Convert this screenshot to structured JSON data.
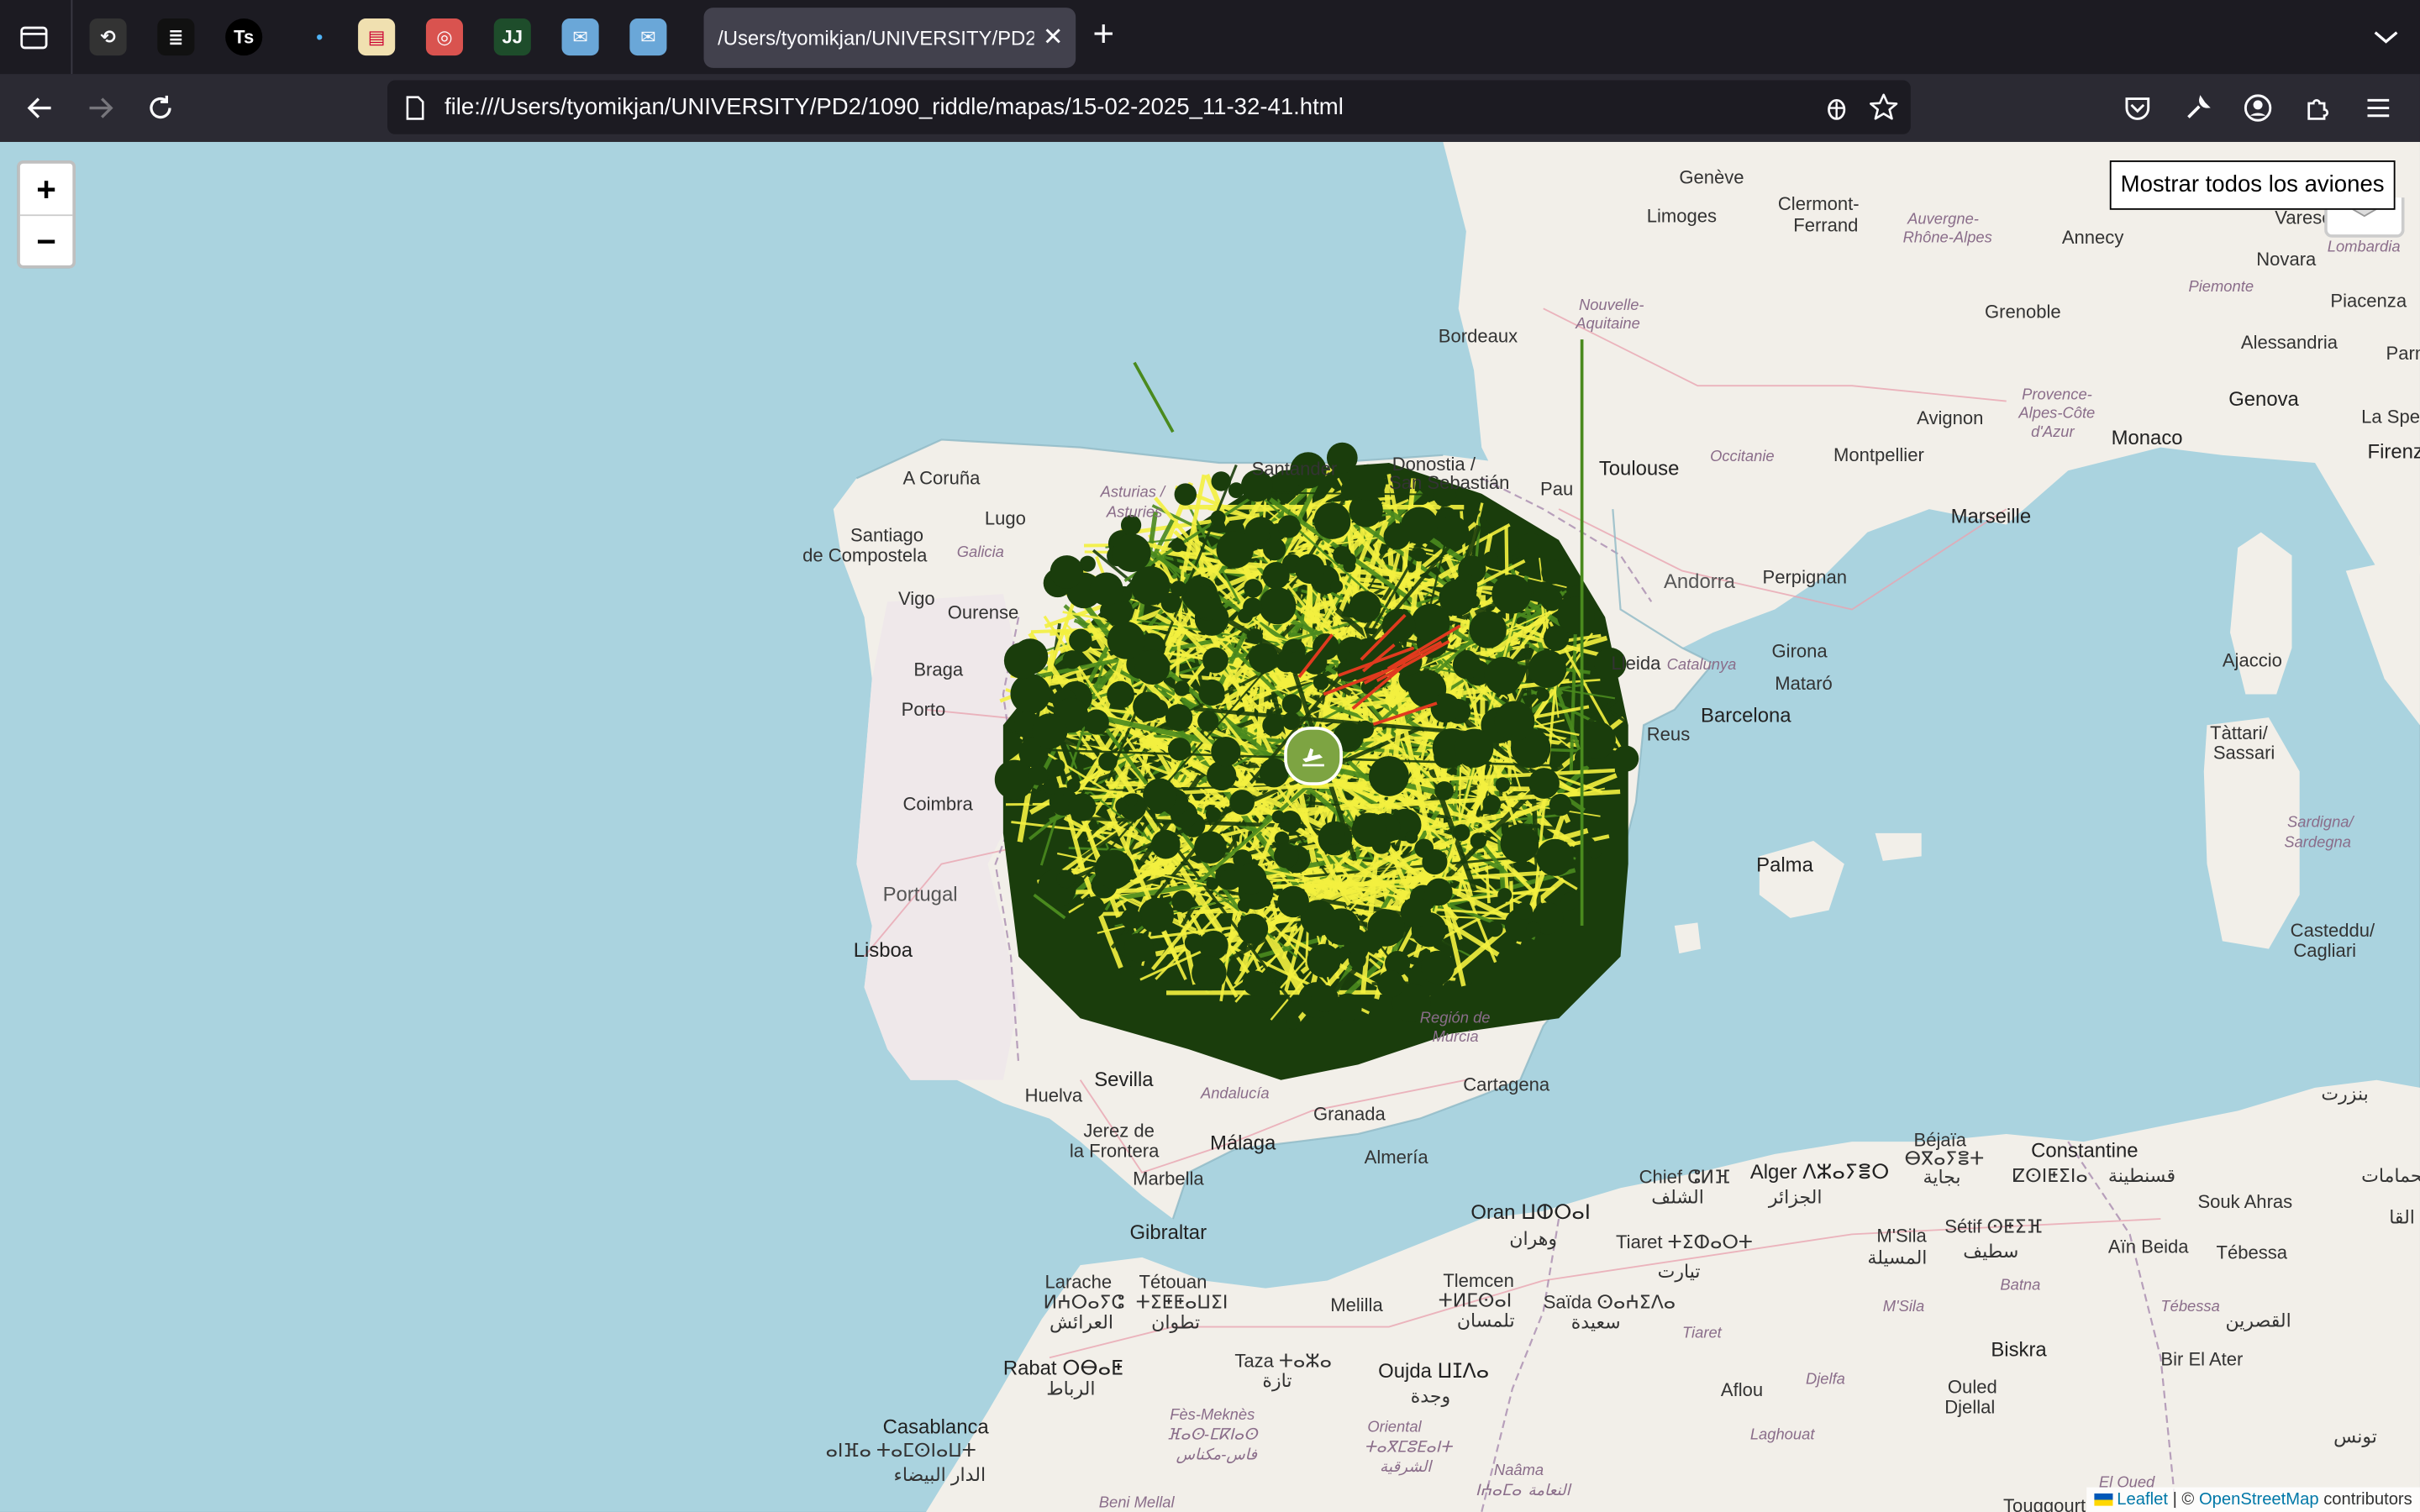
{
  "browser": {
    "active_tab_title": "/Users/tyomikjan/UNIVERSITY/PD2/1090_riddle/mapas/15-02-2025_11-32-41.html",
    "pinned_tabs": [
      {
        "name": "tab-icon-1",
        "glyph": "⟲"
      },
      {
        "name": "tab-icon-2",
        "glyph": "≣"
      },
      {
        "name": "tab-icon-3",
        "glyph": "Ts"
      },
      {
        "name": "tab-icon-4",
        "glyph": "•"
      },
      {
        "name": "tab-icon-5",
        "glyph": "▤"
      },
      {
        "name": "tab-icon-6",
        "glyph": "◎"
      },
      {
        "name": "tab-icon-7",
        "glyph": "JJ"
      },
      {
        "name": "tab-icon-8",
        "glyph": "✉"
      },
      {
        "name": "tab-icon-9",
        "glyph": "✉"
      }
    ],
    "url": "file:///Users/tyomikjan/UNIVERSITY/PD2/1090_riddle/mapas/15-02-2025_11-32-41.html"
  },
  "map": {
    "zoom_in": "+",
    "zoom_out": "−",
    "show_all_button": "Mostrar todos los aviones",
    "attribution": {
      "leaflet": "Leaflet",
      "separator": " | © ",
      "osm": "OpenStreetMap",
      "suffix": " contributors"
    },
    "labels": {
      "geneve": "Genève",
      "limoges": "Limoges",
      "clermont": "Clermont-",
      "ferrand": "Ferrand",
      "annecy": "Annecy",
      "auvergne": "Auvergne-",
      "rhone": "Rhône-Alpes",
      "varese": "Varese",
      "novara": "Novara",
      "lombardia": "Lombardia",
      "piemonte": "Piemonte",
      "piacenza": "Piacenza",
      "alessandria": "Alessandria",
      "parma": "Parma",
      "nouvelle": "Nouvelle-",
      "aquitaine": "Aquitaine",
      "bordeaux": "Bordeaux",
      "grenoble": "Grenoble",
      "provence": "Provence-",
      "alpes": "Alpes-Côte",
      "azur": "d'Azur",
      "genova": "Genova",
      "laspezia": "La Spezia",
      "firenze": "Firenz",
      "avignon": "Avignon",
      "monaco": "Monaco",
      "toulouse": "Toulouse",
      "occitanie": "Occitanie",
      "montpellier": "Montpellier",
      "marseille": "Marseille",
      "acoruna": "A Coruña",
      "lugo": "Lugo",
      "asturias": "Asturias /",
      "asturies": "Asturies",
      "santander": "Santander",
      "donostia": "Donostia /",
      "sansebastian": "San Sebastián",
      "pau": "Pau",
      "santiago": "Santiago",
      "decomp": "de Compostela",
      "galicia": "Galicia",
      "vigo": "Vigo",
      "ourense": "Ourense",
      "andorra": "Andorra",
      "perpignan": "Perpignan",
      "braga": "Braga",
      "lleida": "Lleida",
      "catalunya": "Catalunya",
      "girona": "Girona",
      "mataro": "Mataró",
      "porto": "Porto",
      "barcelona": "Barcelona",
      "ajaccio": "Ajaccio",
      "tattari": "Tàttari/",
      "sassari": "Sassari",
      "reus": "Reus",
      "coimbra": "Coimbra",
      "sardigna": "Sardigna/",
      "sardegna": "Sardegna",
      "portugal": "Portugal",
      "palma": "Palma",
      "lisboa": "Lisboa",
      "casteddu": "Casteddu/",
      "cagliari": "Cagliari",
      "regiondemurcia": "Región de",
      "murcia": "Murcia",
      "huelva": "Huelva",
      "sevilla": "Sevilla",
      "cartagena": "Cartagena",
      "andalucia": "Andalucía",
      "granada": "Granada",
      "jerez": "Jerez de",
      "frontera": "la Frontera",
      "malaga": "Málaga",
      "almeria": "Almería",
      "marbella": "Marbella",
      "gibraltar": "Gibraltar",
      "oran": "Oran ⵡⵀⵔⴰⵏ",
      "wahran": "وهران",
      "chlef": "Chief ⵛⵍⴼ",
      "chlefar": "الشلف",
      "alger": "Alger ⴷⵣⴰⵢⴻⵔ",
      "algerar": "الجزائر",
      "bejaia": "Béjaïa",
      "bgayet": "ⴱⴳⴰⵢⴻⵜ",
      "bejaiaar": "بجاية",
      "constantine": "Constantine",
      "constkab": "ⵇⵙⵏⵟⵉⵏⴰ",
      "constar": "قسنطينة",
      "souk": "Souk Ahras",
      "tiaret": "Tiaret ⵜⵉⵀⴰⵔⵜ",
      "tiaretar": "تيارت",
      "msila": "M'Sila",
      "msilaar": "المسيلة",
      "setif": "Sétif ⵙⵟⵉⴼ",
      "setifar": "سطيف",
      "ainbeida": "Aïn Beida",
      "tebessa": "Tébessa",
      "larache": "Larache",
      "laracheber": "ⵍⵄⵔⴰⵢⵛ",
      "larachear": "العرائش",
      "tetouan": "Tétouan",
      "tetber": "ⵜⵉⵟⵟⴰⵡⵉⵏ",
      "tetar": "تطوان",
      "tlemcen": "Tlemcen",
      "tlember": "ⵜⵍⵎⵙⴰⵏ",
      "tlemar": "تلمسان",
      "saida": "Saïda ⵙⴰⵄⵉⴷⴰ",
      "saidaar": "سعيدة",
      "tiaret2": "Tiaret",
      "batna": "Batna",
      "msila2": "M'Sila",
      "tebessa2": "Tébessa",
      "kasserine": "القصرين",
      "mellila": "Melilla",
      "rabat": "Rabat ⵔⴱⴰⵟ",
      "rabatar": "الرباط",
      "taza": "Taza ⵜⴰⵣⴰ",
      "tazaar": "تازة",
      "oujda": "Oujda ⵡⵊⴷⴰ",
      "oujdaar": "وجدة",
      "djelfa": "Djelfa",
      "aflou": "Aflou",
      "laghouat": "Laghouat",
      "biskra": "Biskra",
      "ouled": "Ouled",
      "djellal": "Djellal",
      "birelater": "Bir El Ater",
      "tunis": "تونس",
      "casablanca": "Casablanca",
      "casaber": "ⴰⵏⴼⴰ ⵜⴰⵎⵙⵏⴰⵡⵜ",
      "casaar": "الدار البيضاء",
      "fes": "Fès-Meknès",
      "fesber": "ⴼⴰⵙ-ⵎⴽⵏⴰⵙ",
      "fesar": "فاس-مكناس",
      "oriental": "Oriental",
      "orientalber": "ⵜⴰⴳⵎⵓⴹⴰⵏⵜ",
      "orientalar": "الشرقية",
      "naama": "Naâma",
      "naamaber": "ⵏⵄⴰⵎⴰ",
      "naamaar": "النعامة",
      "elkef": "El Oued",
      "touggourt": "Touggourt",
      "sidi": "Beni Mellal",
      "bizerte": "بنزرت",
      "hammamet": "الحمامات",
      "kalaa": "القا"
    }
  },
  "colors": {
    "tracks_dark": "#1a3d0c",
    "tracks_mid": "#4a8a1e",
    "tracks_light": "#f4f140",
    "sea": "#aad3df",
    "land": "#f2efe9",
    "red": "#e03a1e"
  }
}
